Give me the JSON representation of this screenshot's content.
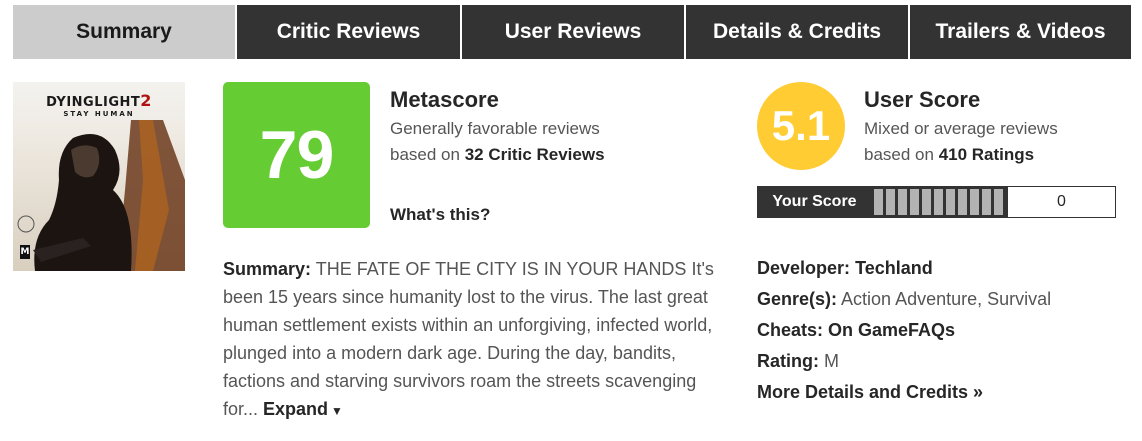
{
  "tabs": [
    {
      "label": "Summary",
      "active": true
    },
    {
      "label": "Critic Reviews",
      "active": false
    },
    {
      "label": "User Reviews",
      "active": false
    },
    {
      "label": "Details & Credits",
      "active": false
    },
    {
      "label": "Trailers & Videos",
      "active": false
    }
  ],
  "cover": {
    "title_part1": "DYINGLIGHT",
    "title_part2": "2",
    "subtitle": "STAY HUMAN",
    "rating_badge": "M"
  },
  "metascore": {
    "score": "79",
    "title": "Metascore",
    "description": "Generally favorable reviews",
    "based_prefix": "based on ",
    "based_count": "32 Critic Reviews",
    "whats_this": "What's this?",
    "color": "#66cc33"
  },
  "user_score": {
    "score": "5.1",
    "title": "User Score",
    "description": "Mixed or average reviews",
    "based_prefix": "based on ",
    "based_count": "410 Ratings",
    "color": "#ffcc33"
  },
  "your_score": {
    "label": "Your Score",
    "value": "0",
    "bar_count": 11
  },
  "summary": {
    "label": "Summary:",
    "text": "THE FATE OF THE CITY IS IN YOUR HANDS It's been 15 years since humanity lost to the virus. The last great human settlement exists within an unforgiving, infected world, plunged into a modern dark age. During the day, bandits, factions and starving survivors roam the streets scavenging for...",
    "expand": "Expand"
  },
  "details": {
    "developer_label": "Developer:",
    "developer": "Techland",
    "genres_label": "Genre(s):",
    "genres": "Action Adventure, Survival",
    "cheats_label": "Cheats:",
    "cheats": "On GameFAQs",
    "rating_label": "Rating:",
    "rating": "M",
    "more": "More Details and Credits »"
  }
}
